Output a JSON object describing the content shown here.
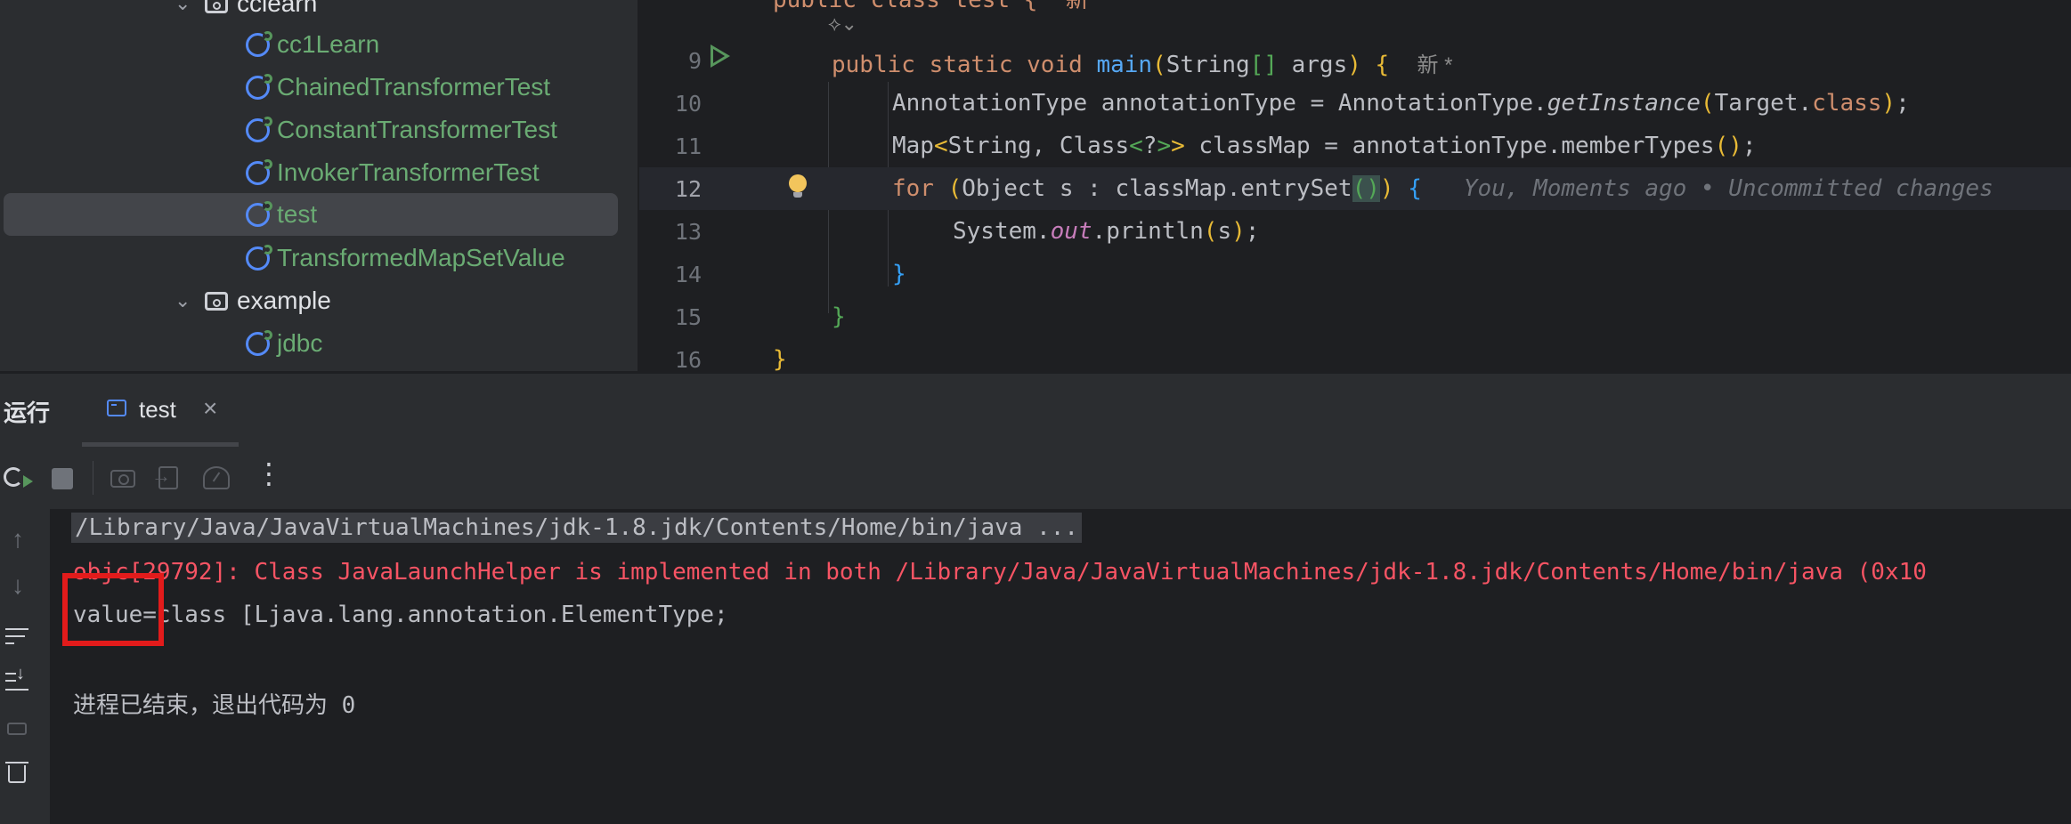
{
  "project_tree": {
    "folder_cclearn": "cclearn",
    "items": [
      {
        "label": "cc1Learn"
      },
      {
        "label": "ChainedTransformerTest"
      },
      {
        "label": "ConstantTransformerTest"
      },
      {
        "label": "InvokerTransformerTest"
      },
      {
        "label": "test"
      },
      {
        "label": "TransformedMapSetValue"
      }
    ],
    "folder_example": "example",
    "example_items": [
      {
        "label": "jdbc"
      }
    ]
  },
  "editor": {
    "line_numbers": [
      "9",
      "10",
      "11",
      "12",
      "13",
      "14",
      "15",
      "16"
    ],
    "partial_top": "public class test {  新",
    "line9": {
      "kw1": "public",
      "kw2": "static",
      "kw3": "void",
      "fn": "main",
      "open": "(",
      "type": "String",
      "arr": "[]",
      "arg": " args",
      "close": ")",
      "brace": "{",
      "hint": "新 *"
    },
    "line10": {
      "lhs": "AnnotationType annotationType = AnnotationType.",
      "method": "getInstance",
      "open": "(",
      "arg": "Target.",
      "kw": "class",
      "close": ")",
      "end": ";"
    },
    "line11": {
      "a": "Map",
      "lt": "<",
      "b": "String, Class",
      "lt2": "<",
      "q": "?",
      "gt2": ">",
      "gt": ">",
      "c": " classMap = annotationType.memberTypes",
      "parens": "()",
      "end": ";"
    },
    "line12": {
      "kw": "for",
      "open": "(",
      "body": "Object s : classMap.entrySet",
      "parens": "()",
      "close": ")",
      "brace": "{",
      "inlay": "You, Moments ago • Uncommitted changes"
    },
    "line13": {
      "a": "System.",
      "field": "out",
      "b": ".println",
      "open": "(",
      "arg": "s",
      "close": ")",
      "end": ";"
    },
    "line14": "}",
    "line15": "}",
    "line16": "}"
  },
  "run_panel": {
    "title": "运行",
    "tab_label": "test",
    "tab_close": "×",
    "more": "⋮"
  },
  "console": {
    "cmd": "/Library/Java/JavaVirtualMachines/jdk-1.8.jdk/Contents/Home/bin/java ...",
    "error": "objc[29792]: Class JavaLaunchHelper is implemented in both /Library/Java/JavaVirtualMachines/jdk-1.8.jdk/Contents/Home/bin/java (0x10",
    "output": "value=class [Ljava.lang.annotation.ElementType;",
    "exit": "进程已结束，退出代码为 0"
  },
  "colors": {
    "keyword": "#cf8e6d",
    "function": "#56a8f5",
    "error": "#f75464",
    "annotation_box": "#e21b1b",
    "test_green": "#6aab73"
  },
  "icons": {
    "class_icon": "test-class-icon",
    "folder_icon": "package-folder-icon",
    "run": "run-gutter-icon",
    "bulb": "intention-bulb-icon"
  }
}
